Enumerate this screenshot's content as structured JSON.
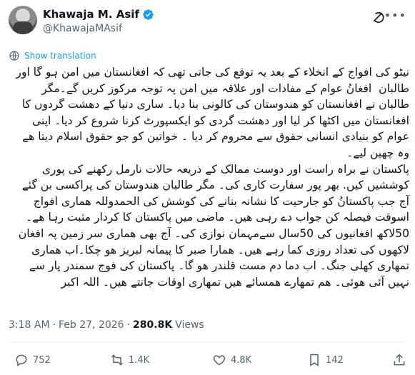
{
  "author": {
    "display_name": "Khawaja M. Asif",
    "handle": "@KhawajaMAsif",
    "avatar_icon": "avatar",
    "verified_color": "#1d9bf0"
  },
  "translation": {
    "label": "Show translation"
  },
  "post": {
    "text": "نیٹو کی افواج کے انخلاء کے بعد یہ توقع کی جاتی تھی کہ افغانستان میں امن ہو گا اور طالبان  افغانُ عوام کے مفادات اور علاقہ میں امن پہ توجہ مرکوز کریں گے۔مگر طالبان نے افغانستان کو ھندوستان کی کالونی بنا دیا۔ ساری دنیا کے دھشت گردوں کا افغانستان میں اکٹھا کر لیا اور دھشت گردی کو ایکسپورٹ کرنا شروع کر دیا۔ اپنی عوام کو بنیادی انسانی حقوق سے محروم کر دیا ۔ خواتین کو جو حقوق اسلام دیتا ھے وہ چھین لیے۔\nپاکستان نے براہ راست اور دوست ممالک کے ذریعہ حالات نارمل رکھنے کی پوری کوششیں کیں. بھر پور سفارت کاری کی۔ مگر طالبان ھندوستان کی پراکسی بن گئے آج جب پاکستانُ کو جارحیت کا نشانہ بنانے کی کوشش کی الحمدوللہ ھماری افواج اسوقت فیصلہ کن جواب دے رہی ھیں۔ ماضی میں پاکستان کا کردار مثبت رہا ھے۔ 50لاکھ افغانیوں کی 50سال سےمہمان نوازی کی۔ آج بھی ھماری سر زمین پہ افغان لاکھوں کی تعداد روزی کما رہے ھیں۔ ھمارا صبر کا پیمانہ لبریز ھو چکا۔اب ھماری تمھاری کھلی جنگ۔ اب دما دم مست قلندر ھو گا۔ پاکستان کی فوج سمندر پار سے نہیں آئی ھوئی۔ ھم تمھارے ھمسائے ھیں تمھاری اوقات جانتے ھیں۔ اللہ اکبر"
  },
  "meta": {
    "time": "3:18 AM",
    "separator": "·",
    "date": "Feb 27, 2026",
    "separator2": "·",
    "views_count": "280.8K",
    "views_label": "Views"
  },
  "actions": {
    "replies": "752",
    "reposts": "1.4K",
    "likes": "4.8K",
    "bookmarks": "142"
  },
  "colors": {
    "text": "#0f1419",
    "muted": "#536471",
    "accent": "#1d9bf0",
    "divider": "#eff3f4"
  }
}
